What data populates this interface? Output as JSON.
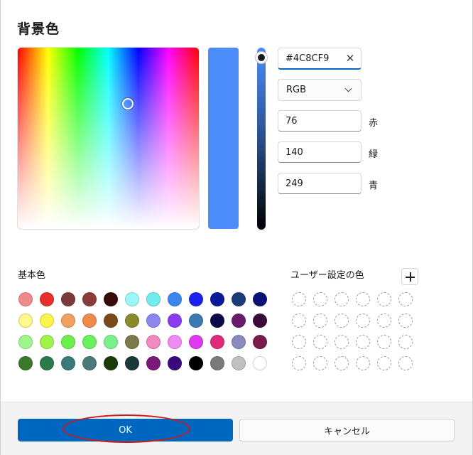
{
  "dialog": {
    "title": "背景色"
  },
  "color": {
    "current_hex": "#4c8cf9",
    "hex_field_value": "#4C8CF9",
    "mode_select": {
      "selected": "RGB"
    },
    "channels": [
      {
        "value": "76",
        "label": "赤"
      },
      {
        "value": "140",
        "label": "緑"
      },
      {
        "value": "249",
        "label": "青"
      }
    ]
  },
  "basic_colors": {
    "label": "基本色",
    "swatches": [
      "#f08a8a",
      "#e8302a",
      "#7a3b3b",
      "#8c3b3b",
      "#3a0a0a",
      "#9cf8f8",
      "#70eeee",
      "#3c86f0",
      "#1a22f0",
      "#0a189a",
      "#1a3a78",
      "#0a1278",
      "#fffa8a",
      "#fbf54a",
      "#f0a060",
      "#f08a4a",
      "#7a4a1a",
      "#8a8a2a",
      "#8a88f0",
      "#8a3af0",
      "#3a7ab0",
      "#0a0a48",
      "#6a1a6a",
      "#3a0a3a",
      "#9ef58a",
      "#9ef54a",
      "#6af04a",
      "#6af060",
      "#7af08a",
      "#7a7a4a",
      "#f08ac0",
      "#f08af0",
      "#e03af0",
      "#e02a7a",
      "#8a8ac0",
      "#7a1a48",
      "#3a7a2a",
      "#2a7a4a",
      "#3a7a7a",
      "#4a7a7a",
      "#1a3a0a",
      "#1a3a3a",
      "#7a1a7a",
      "#3a0a7a",
      "#000000",
      "#7a7a7a",
      "#c0c0c0",
      "#ffffff"
    ]
  },
  "custom_colors": {
    "label": "ユーザー設定の色",
    "slot_count": 24
  },
  "footer": {
    "ok_label": "OK",
    "cancel_label": "キャンセル"
  },
  "icons": {
    "clear": "close-icon",
    "dropdown": "chevron-down-icon",
    "add": "plus-icon"
  }
}
